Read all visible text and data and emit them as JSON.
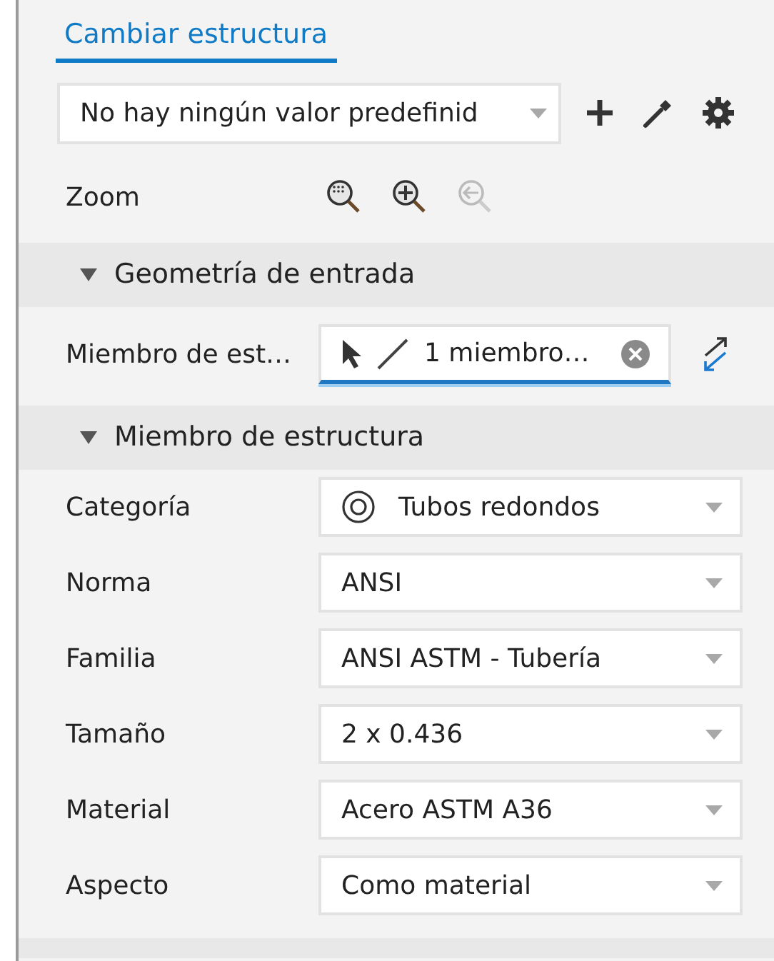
{
  "tab": {
    "label": "Cambiar estructura"
  },
  "preset": {
    "value": "No hay ningún valor predefinid"
  },
  "zoom": {
    "label": "Zoom",
    "buttons": [
      {
        "kind": "fit",
        "disabled": false
      },
      {
        "kind": "in",
        "disabled": false
      },
      {
        "kind": "previous",
        "disabled": true
      }
    ]
  },
  "sections": [
    {
      "title": "Geometría de entrada",
      "expanded": true,
      "rows": [
        {
          "kind": "selection",
          "label": "Miembro de est…",
          "value": "1 miembro…",
          "focused": true
        }
      ]
    },
    {
      "title": "Miembro de estructura",
      "expanded": true,
      "rows": [
        {
          "kind": "iconselect",
          "label": "Categoría",
          "value": "Tubos redondos"
        },
        {
          "kind": "dropdown",
          "label": "Norma",
          "value": "ANSI"
        },
        {
          "kind": "dropdown",
          "label": "Familia",
          "value": "ANSI ASTM - Tubería"
        },
        {
          "kind": "dropdown",
          "label": "Tamaño",
          "value": "2 x 0.436"
        },
        {
          "kind": "dropdown",
          "label": "Material",
          "value": "Acero ASTM A36"
        },
        {
          "kind": "dropdown",
          "label": "Aspecto",
          "value": "Como material"
        }
      ]
    }
  ]
}
